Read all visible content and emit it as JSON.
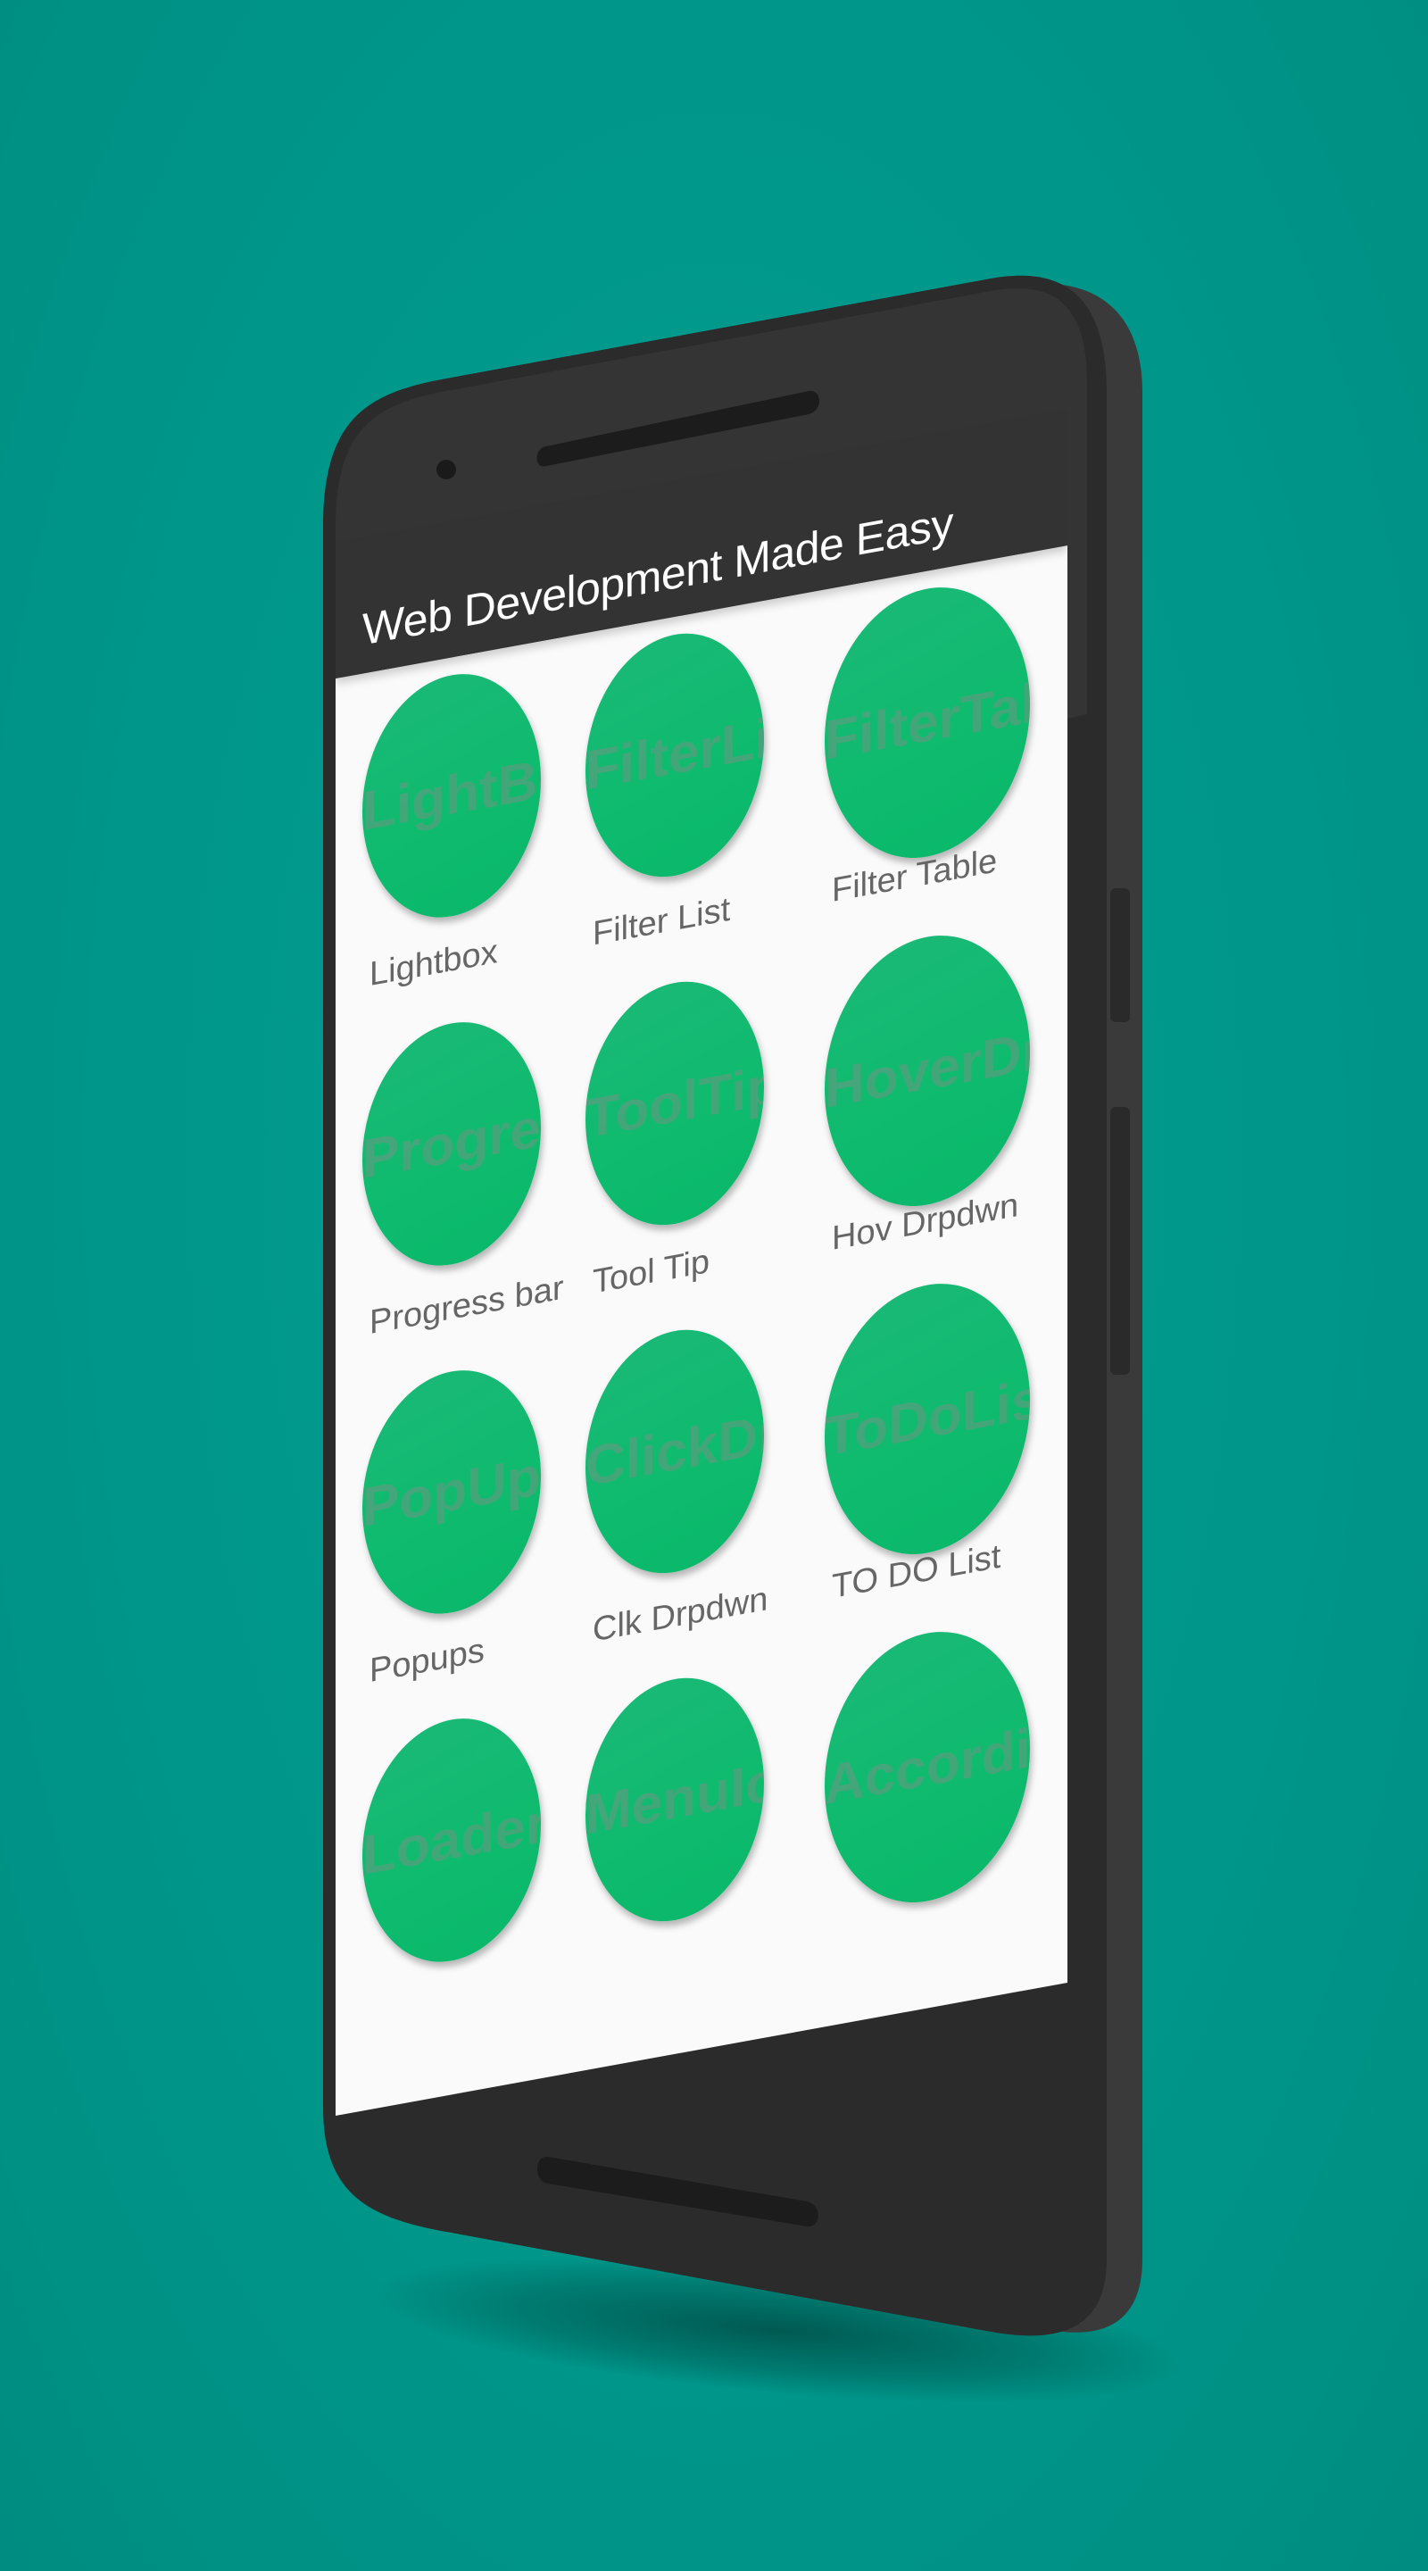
{
  "app": {
    "title": "Web Development Made Easy"
  },
  "tiles": [
    {
      "label": "Lightbox",
      "image_text": "LightBox"
    },
    {
      "label": "Filter List",
      "image_text": "FilterList"
    },
    {
      "label": "Filter Table",
      "image_text": "FilterTable"
    },
    {
      "label": "Progress bar",
      "image_text": "Progress"
    },
    {
      "label": "Tool Tip",
      "image_text": "ToolTip"
    },
    {
      "label": "Hov Drpdwn",
      "image_text": "HoverDrop"
    },
    {
      "label": "Popups",
      "image_text": "PopUps"
    },
    {
      "label": "Clk Drpdwn",
      "image_text": "ClickDrop"
    },
    {
      "label": "TO DO List",
      "image_text": "ToDoList"
    },
    {
      "label": "",
      "image_text": "Loaders"
    },
    {
      "label": "",
      "image_text": "MenuIcon"
    },
    {
      "label": "",
      "image_text": "Accordion"
    }
  ],
  "colors": {
    "background": "#00968a",
    "phone_body": "#2b2b2b",
    "app_bar": "#333333",
    "tile_green": "#0fbb6f",
    "content_bg": "#fafafa"
  }
}
